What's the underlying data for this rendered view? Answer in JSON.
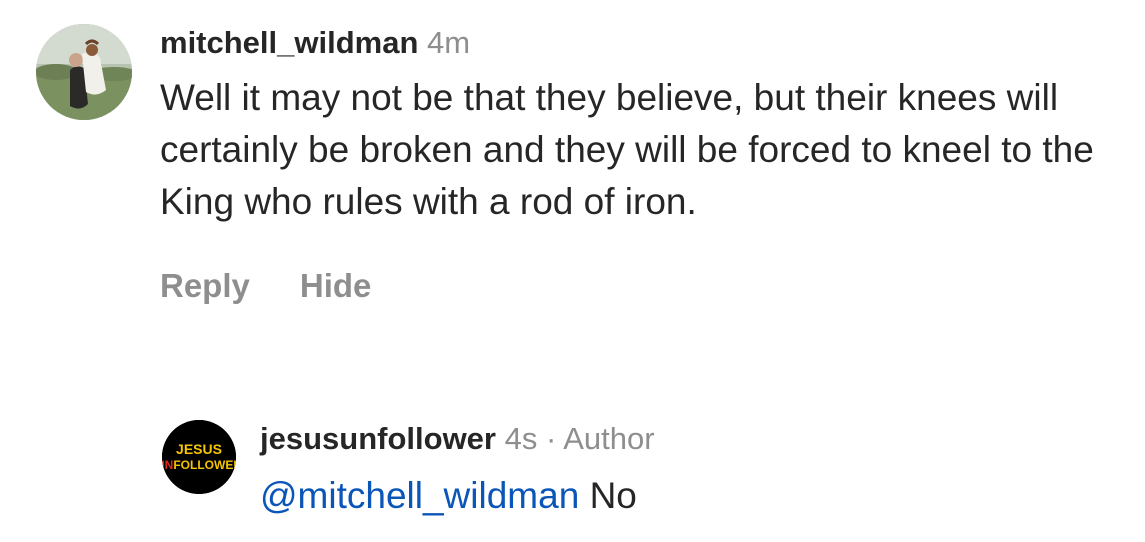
{
  "comments": [
    {
      "username": "mitchell_wildman",
      "time": "4m",
      "text": "Well it may not be that they believe, but their knees will certainly be broken and they will be forced to kneel to the King who rules with a rod of iron.",
      "actions": {
        "reply": "Reply",
        "hide": "Hide"
      }
    }
  ],
  "reply": {
    "username": "jesusunfollower",
    "time": "4s",
    "separator": "·",
    "author_label": "Author",
    "mention": "@mitchell_wildman",
    "text": "No",
    "avatar_text": {
      "line1": "JESUS",
      "line2_red": "UN",
      "line2_rest": "FOLLOWER"
    }
  },
  "colors": {
    "text": "#262626",
    "meta": "#8e8e8e",
    "mention": "#0a55b8",
    "logo_yellow": "#f5c400",
    "logo_red": "#e0261c"
  }
}
